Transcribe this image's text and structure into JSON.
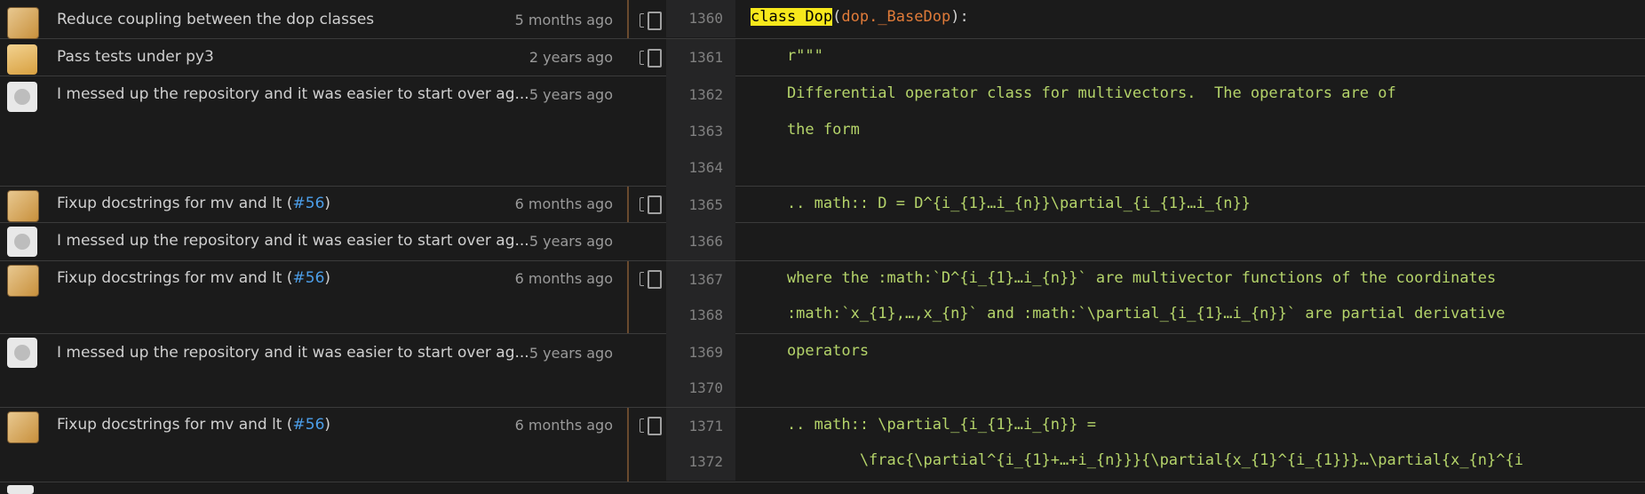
{
  "rows": [
    {
      "message": "Reduce coupling between the dop classes",
      "pr": "",
      "time": "5 months ago",
      "avatar": "robot-avatar"
    },
    {
      "message": "Pass tests under py3",
      "pr": "",
      "time": "2 years ago",
      "avatar": "duck-avatar"
    },
    {
      "message": "I messed up the repository and it was easier to start over ag...",
      "pr": "",
      "time": "5 years ago",
      "avatar": "github-avatar"
    },
    {
      "message": "Fixup docstrings for mv and lt (",
      "pr": "#56",
      "suffix": ")",
      "time": "6 months ago",
      "avatar": "robot-avatar"
    },
    {
      "message": "I messed up the repository and it was easier to start over ag...",
      "pr": "",
      "time": "5 years ago",
      "avatar": "github-avatar"
    },
    {
      "message": "Fixup docstrings for mv and lt (",
      "pr": "#56",
      "suffix": ")",
      "time": "6 months ago",
      "avatar": "robot-avatar"
    },
    {
      "message": "I messed up the repository and it was easier to start over ag...",
      "pr": "",
      "time": "5 years ago",
      "avatar": "github-avatar"
    },
    {
      "message": "Fixup docstrings for mv and lt (",
      "pr": "#56",
      "suffix": ")",
      "time": "6 months ago",
      "avatar": "robot-avatar"
    }
  ],
  "lines": [
    {
      "num": "1360",
      "code_kw": "class Dop",
      "code_rest_fg1": "(",
      "code_mod": "dop._BaseDop",
      "code_rest_fg2": "):"
    },
    {
      "num": "1361",
      "code": "    r\"\"\""
    },
    {
      "num": "1362",
      "code": "    Differential operator class for multivectors.  The operators are of"
    },
    {
      "num": "1363",
      "code": "    the form"
    },
    {
      "num": "1364",
      "code": ""
    },
    {
      "num": "1365",
      "code": "    .. math:: D = D^{i_{1}…i_{n}}\\partial_{i_{1}…i_{n}}"
    },
    {
      "num": "1366",
      "code": ""
    },
    {
      "num": "1367",
      "code": "    where the :math:`D^{i_{1}…i_{n}}` are multivector functions of the coordinates"
    },
    {
      "num": "1368",
      "code": "    :math:`x_{1},…,x_{n}` and :math:`\\partial_{i_{1}…i_{n}}` are partial derivative"
    },
    {
      "num": "1369",
      "code": "    operators"
    },
    {
      "num": "1370",
      "code": ""
    },
    {
      "num": "1371",
      "code": "    .. math:: \\partial_{i_{1}…i_{n}} ="
    },
    {
      "num": "1372",
      "code": "            \\frac{\\partial^{i_{1}+…+i_{n}}}{\\partial{x_{1}^{i_{1}}}…\\partial{x_{n}^{i"
    }
  ]
}
